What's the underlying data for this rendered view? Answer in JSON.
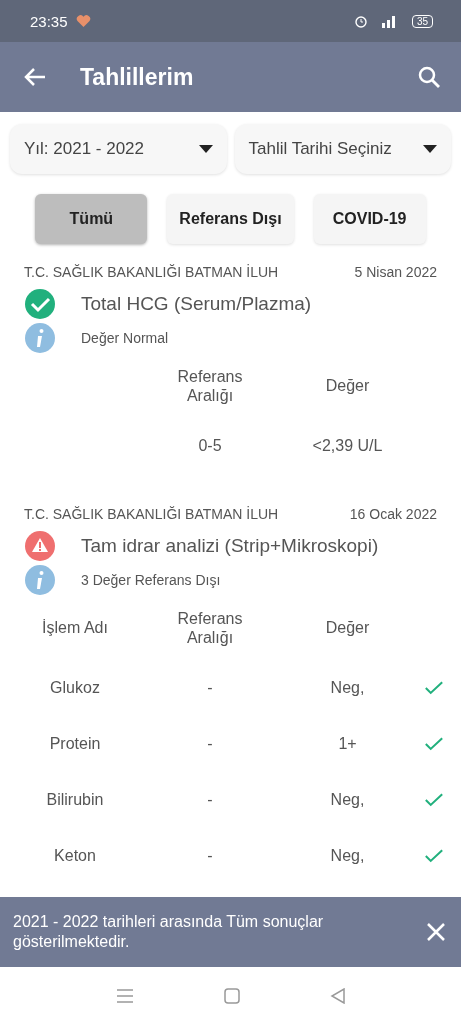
{
  "status_bar": {
    "time": "23:35",
    "battery": "35"
  },
  "app_bar": {
    "title": "Tahlillerim"
  },
  "filters": [
    {
      "label": "Yıl: 2021 - 2022"
    },
    {
      "label": "Tahlil Tarihi Seçiniz"
    }
  ],
  "chips": [
    {
      "label": "Tümü",
      "selected": true
    },
    {
      "label": "Referans Dışı",
      "selected": false
    },
    {
      "label": "COVID-19",
      "selected": false
    }
  ],
  "results": [
    {
      "institution": "T.C. SAĞLIK BAKANLIĞI BATMAN İLUH",
      "date": "5 Nisan 2022",
      "kind": "normal",
      "name": "Total HCG (Serum/Plazma)",
      "summary": "Değer Normal",
      "columns": [
        null,
        "Referans Aralığı",
        "Değer"
      ],
      "rows": [
        {
          "name": null,
          "range": "0-5",
          "value": "<2,39 U/L"
        }
      ]
    },
    {
      "institution": "T.C. SAĞLIK BAKANLIĞI BATMAN İLUH",
      "date": "16 Ocak 2022",
      "kind": "abnormal",
      "name": "Tam idrar analizi (Strip+Mikroskopi)",
      "summary": "3 Değer Referans Dışı",
      "columns": [
        "İşlem Adı",
        "Referans Aralığı",
        "Değer"
      ],
      "rows": [
        {
          "name": "Glukoz",
          "range": "-",
          "value": "Neg,",
          "checked": true
        },
        {
          "name": "Protein",
          "range": "-",
          "value": "1+",
          "checked": true
        },
        {
          "name": "Bilirubin",
          "range": "-",
          "value": "Neg,",
          "checked": true
        },
        {
          "name": "Keton",
          "range": "-",
          "value": "Neg,",
          "checked": true
        }
      ]
    }
  ],
  "snackbar": {
    "message": "2021 - 2022 tarihleri arasında Tüm sonuçlar gösterilmektedir."
  }
}
